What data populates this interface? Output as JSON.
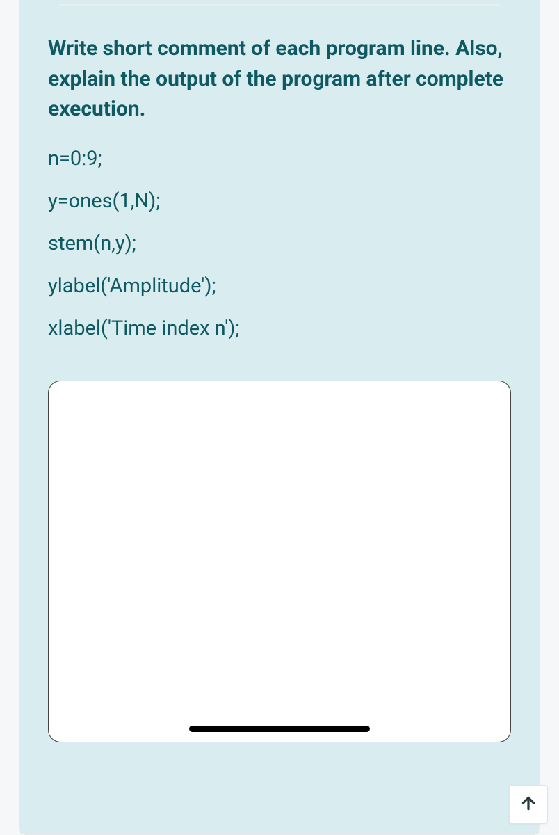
{
  "question": {
    "prompt": "Write short comment of each program line. Also, explain the output of the program after complete execution.",
    "code": [
      "n=0:9;",
      "y=ones(1,N);",
      "stem(n,y);",
      "ylabel('Amplitude');",
      "xlabel('Time index n');"
    ]
  },
  "scroll_top": {
    "icon_name": "arrow-up"
  }
}
